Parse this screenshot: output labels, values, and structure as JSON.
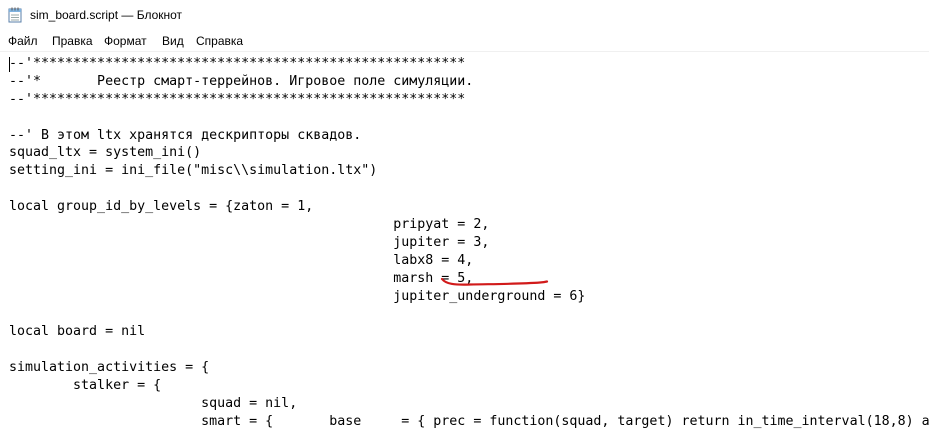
{
  "window": {
    "title": "sim_board.script — Блокнот",
    "icon": "notepad-icon"
  },
  "menu": {
    "items": [
      "Файл",
      "Правка",
      "Формат",
      "Вид",
      "Справка"
    ]
  },
  "editor": {
    "lines": [
      "--'******************************************************",
      "--'*       Реестр смарт-террейнов. Игровое поле симуляции.",
      "--'******************************************************",
      "",
      "--' В этом ltx хранятся дескрипторы сквадов.",
      "squad_ltx = system_ini()",
      "setting_ini = ini_file(\"misc\\\\simulation.ltx\")",
      "",
      "local group_id_by_levels = {zaton = 1,",
      "                                                pripyat = 2,",
      "                                                jupiter = 3,",
      "                                                labx8 = 4,",
      "                                                marsh = 5,",
      "                                                jupiter_underground = 6}",
      "",
      "local board = nil",
      "",
      "simulation_activities = {",
      "        stalker = {",
      "                        squad = nil,",
      "                        smart = {       base     = { prec = function(squad, target) return in_time_interval(18,8) a"
    ],
    "annotation_color": "#d11a1a"
  }
}
